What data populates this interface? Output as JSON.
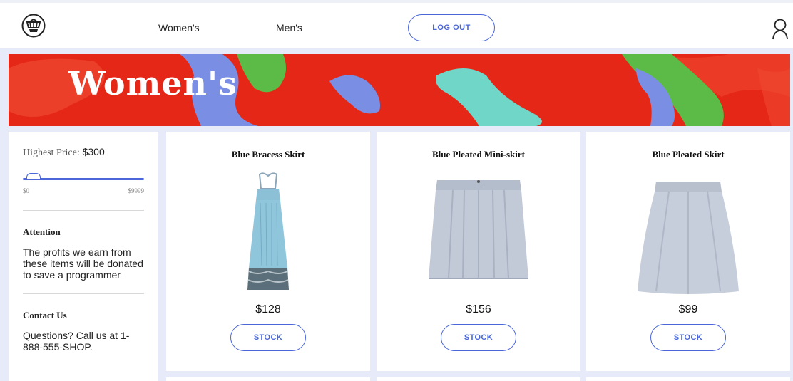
{
  "nav": {
    "logo_icon": "shop-basket-icon",
    "links": [
      "Women's",
      "Men's"
    ],
    "logout_label": "LOG OUT",
    "user_icon": "user-icon"
  },
  "banner": {
    "title": "Women's",
    "colors": {
      "base": "#e52718",
      "blue": "#7a8fe3",
      "green": "#5bbb46",
      "teal": "#6fd6c8"
    }
  },
  "sidebar": {
    "price_label": "Highest Price:",
    "price_value": "$300",
    "slider_min": "$0",
    "slider_max": "$9999",
    "slider_level_fraction": 0.03,
    "attention_title": "Attention",
    "attention_body": "The profits we earn from these items will be donated to save a programmer",
    "contact_title": "Contact Us",
    "contact_body": "Questions? Call us at 1-888-555-SHOP."
  },
  "products": [
    {
      "name": "Blue Bracess Skirt",
      "price": "$128",
      "button": "STOCK",
      "image": "blue-halter-dress"
    },
    {
      "name": "Blue Pleated Mini-skirt",
      "price": "$156",
      "button": "STOCK",
      "image": "grey-pleated-mini-skirt"
    },
    {
      "name": "Blue Pleated Skirt",
      "price": "$99",
      "button": "STOCK",
      "image": "grey-flared-skirt"
    }
  ],
  "colors": {
    "accent": "#4a66d8",
    "layout_bg": "#e7ebf9"
  }
}
